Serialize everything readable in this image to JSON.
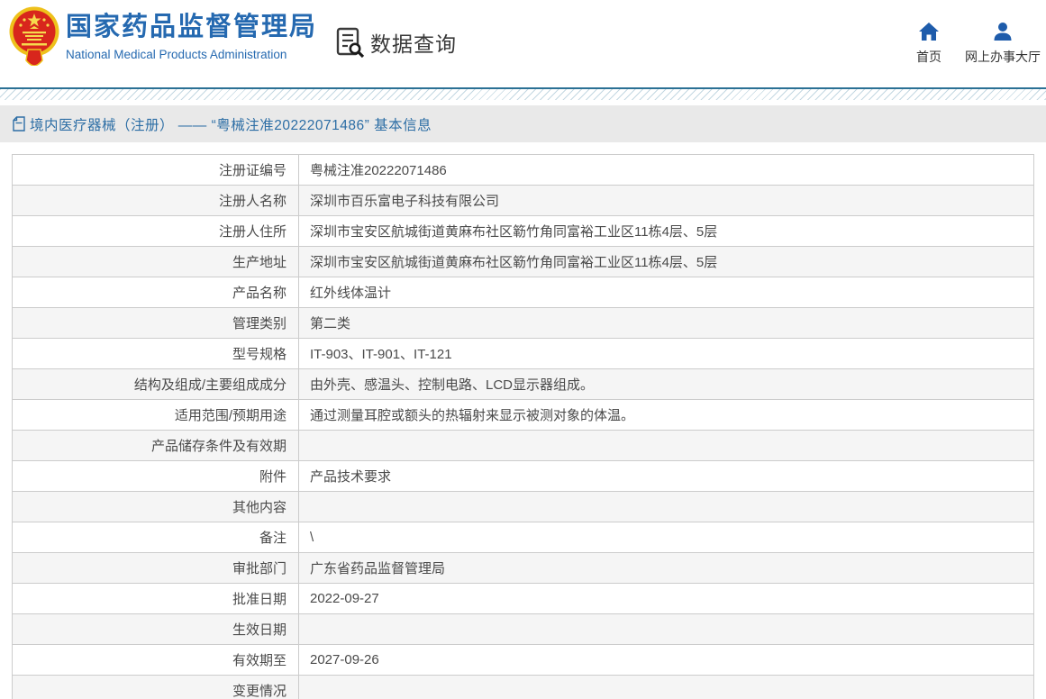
{
  "header": {
    "org_name_cn": "国家药品监督管理局",
    "org_name_en": "National Medical Products Administration",
    "section_title": "数据查询",
    "nav": [
      {
        "label": "首页",
        "icon": "home-icon"
      },
      {
        "label": "网上办事大厅",
        "icon": "user-icon"
      }
    ],
    "brand_color": "#2569b0",
    "nav_icon_color": "#1e5cab"
  },
  "breadcrumb": {
    "title": "境内医疗器械（注册） —— “粤械注准20222071486” 基本信息"
  },
  "table": {
    "rows": [
      {
        "label": "注册证编号",
        "value": "粤械注准20222071486"
      },
      {
        "label": "注册人名称",
        "value": "深圳市百乐富电子科技有限公司"
      },
      {
        "label": "注册人住所",
        "value": "深圳市宝安区航城街道黄麻布社区簕竹角同富裕工业区11栋4层、5层"
      },
      {
        "label": "生产地址",
        "value": "深圳市宝安区航城街道黄麻布社区簕竹角同富裕工业区11栋4层、5层"
      },
      {
        "label": "产品名称",
        "value": "红外线体温计"
      },
      {
        "label": "管理类别",
        "value": "第二类"
      },
      {
        "label": "型号规格",
        "value": "IT-903、IT-901、IT-121"
      },
      {
        "label": "结构及组成/主要组成成分",
        "value": "由外壳、感温头、控制电路、LCD显示器组成。"
      },
      {
        "label": "适用范围/预期用途",
        "value": "通过测量耳腔或额头的热辐射来显示被测对象的体温。"
      },
      {
        "label": "产品储存条件及有效期",
        "value": ""
      },
      {
        "label": "附件",
        "value": "产品技术要求"
      },
      {
        "label": "其他内容",
        "value": ""
      },
      {
        "label": "备注",
        "value": "\\"
      },
      {
        "label": "审批部门",
        "value": "广东省药品监督管理局"
      },
      {
        "label": "批准日期",
        "value": "2022-09-27"
      },
      {
        "label": "生效日期",
        "value": ""
      },
      {
        "label": "有效期至",
        "value": "2027-09-26"
      },
      {
        "label": "变更情况",
        "value": ""
      }
    ]
  }
}
